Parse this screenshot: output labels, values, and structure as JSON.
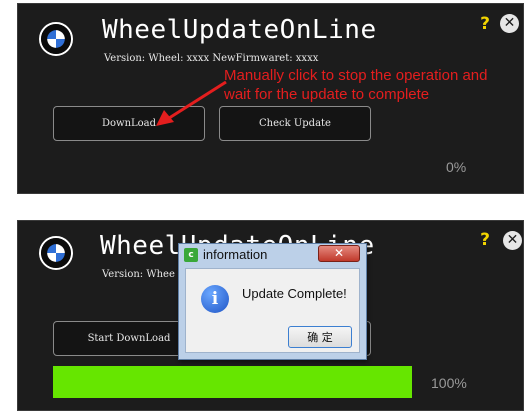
{
  "panel_top": {
    "title": "WheelUpdateOnLine",
    "version_text": "Version: Wheel: xxxx NewFirmwaret: xxxx",
    "help_glyph": "?",
    "close_glyph": "✕",
    "download_label": "DownLoad",
    "check_update_label": "Check Update",
    "progress_text": "0%",
    "progress_value": 0
  },
  "annotation": {
    "line1": "Manually click to stop the operation and",
    "line2": "wait for the update to complete",
    "color": "#e41e1e"
  },
  "panel_bottom": {
    "title": "WheelUpdateOnLine",
    "version_text": "Version: Whee",
    "help_glyph": "?",
    "close_glyph": "✕",
    "start_download_label": "Start DownLoad",
    "progress_text": "100%",
    "progress_value": 1.0,
    "progress_color": "#66e600"
  },
  "dialog": {
    "title": "information",
    "close_glyph": "✕",
    "info_glyph": "i",
    "message": "Update Complete!",
    "ok_label": "确 定"
  },
  "icons": {
    "logo": "bmw-roundel-logo-icon",
    "help": "help-icon",
    "close": "close-icon",
    "info": "information-icon",
    "app": "app-icon"
  },
  "colors": {
    "panel_bg": "#1c1c1c",
    "help_yellow": "#f2d400",
    "logo_blue": "#2f6fd6"
  }
}
